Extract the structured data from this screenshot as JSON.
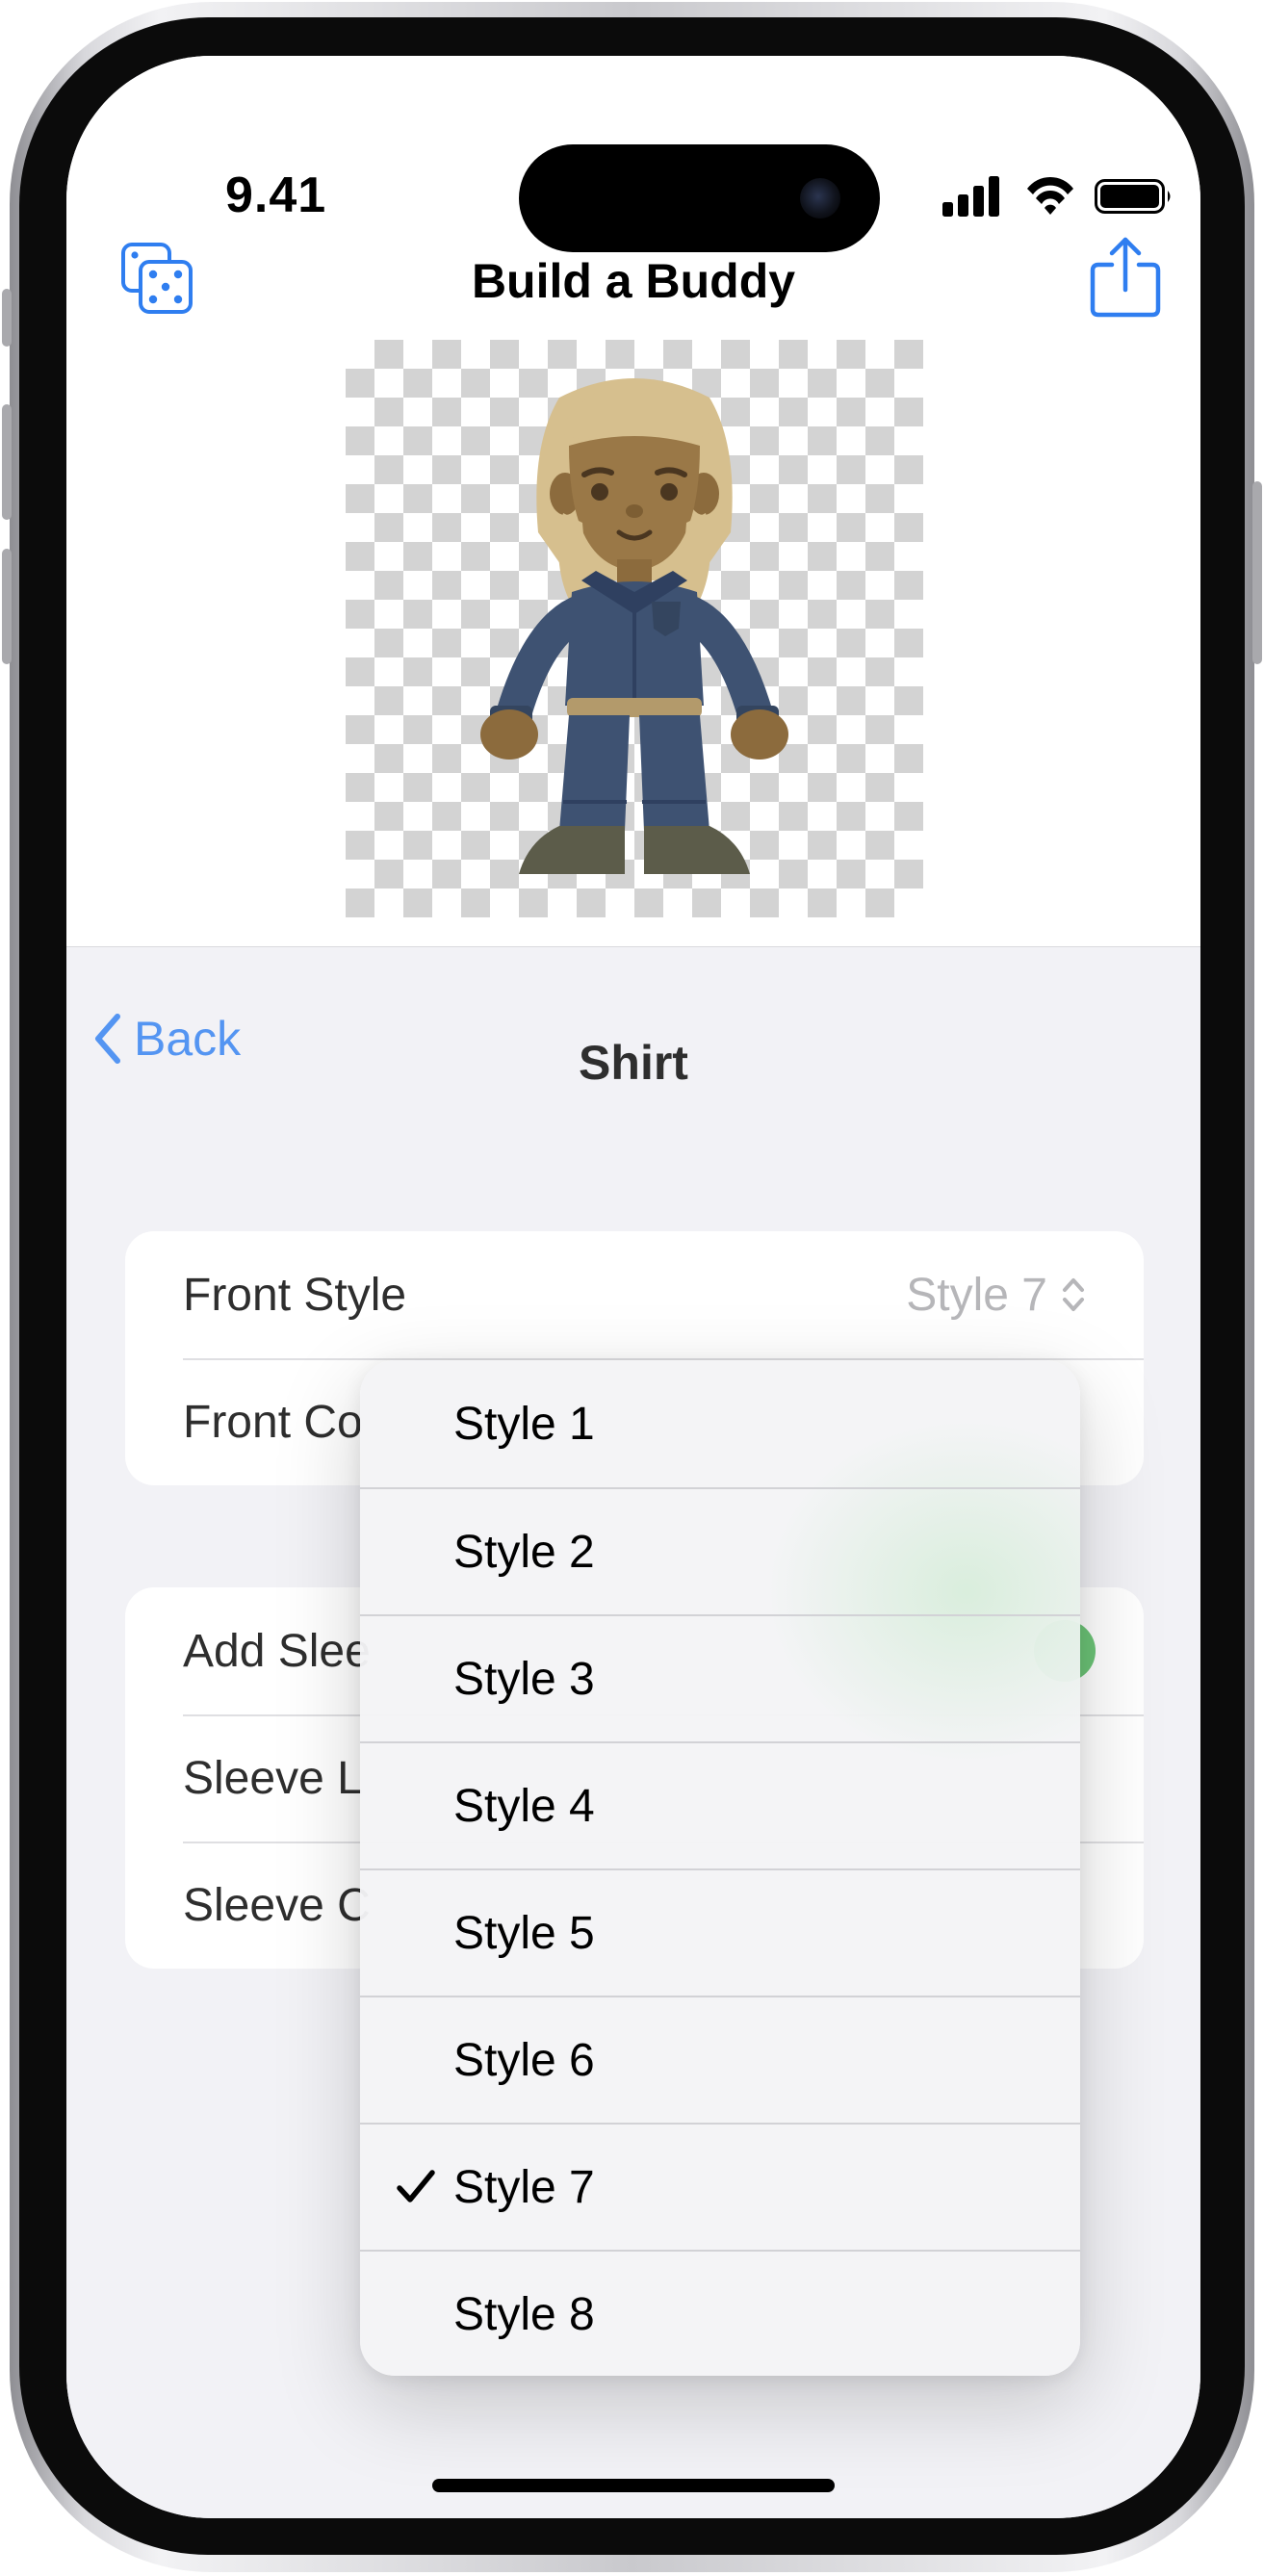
{
  "status_bar": {
    "time": "9.41",
    "icons": [
      "signal-icon",
      "wifi-icon",
      "battery-icon"
    ]
  },
  "header": {
    "title": "Build a Buddy",
    "left_icon": "dice-icon",
    "right_icon": "share-icon"
  },
  "sheet": {
    "back_label": "Back",
    "title": "Shirt"
  },
  "group1": {
    "front_style_label": "Front Style",
    "front_style_value": "Style 7",
    "front_color_label": "Front Co"
  },
  "group2": {
    "add_sleeves_label": "Add Slee",
    "sleeve_length_label": "Sleeve L",
    "sleeve_color_label": "Sleeve C"
  },
  "menu": {
    "items": [
      "Style 1",
      "Style 2",
      "Style 3",
      "Style 4",
      "Style 5",
      "Style 6",
      "Style 7",
      "Style 8"
    ],
    "selected": "Style 7"
  },
  "colors": {
    "accent": "#2f7ef0",
    "toggle_on": "#4cb85a",
    "secondary_text": "#a6a6aa",
    "sheet_bg": "#efeff4"
  }
}
